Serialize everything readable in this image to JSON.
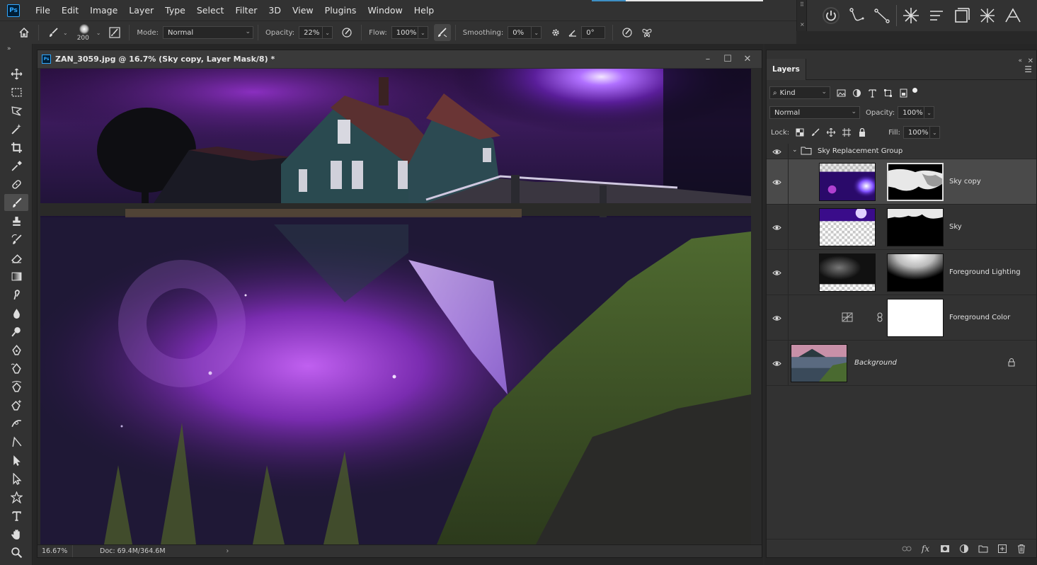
{
  "app": {
    "logo_text": "Ps",
    "menu": [
      "File",
      "Edit",
      "Image",
      "Layer",
      "Type",
      "Select",
      "Filter",
      "3D",
      "View",
      "Plugins",
      "Window",
      "Help"
    ]
  },
  "options_bar": {
    "brush_size": "200",
    "mode_label": "Mode:",
    "mode_value": "Normal",
    "opacity_label": "Opacity:",
    "opacity_value": "22%",
    "flow_label": "Flow:",
    "flow_value": "100%",
    "smoothing_label": "Smoothing:",
    "smoothing_value": "0%",
    "angle_value": "0°"
  },
  "document": {
    "title": "ZAN_3059.jpg @ 16.7% (Sky copy, Layer Mask/8) *",
    "zoom": "16.67%",
    "doc_size": "Doc: 69.4M/364.6M"
  },
  "layers_panel": {
    "tab_label": "Layers",
    "filter_kind": "Kind",
    "blend_mode": "Normal",
    "opacity_label": "Opacity:",
    "opacity_value": "100%",
    "lock_label": "Lock:",
    "fill_label": "Fill:",
    "fill_value": "100%",
    "layers": [
      {
        "name": "Sky Replacement Group",
        "type": "group"
      },
      {
        "name": "Sky copy",
        "type": "pixel_mask",
        "selected": true
      },
      {
        "name": "Sky",
        "type": "pixel_mask"
      },
      {
        "name": "Foreground Lighting",
        "type": "pixel_mask"
      },
      {
        "name": "Foreground Color",
        "type": "adjustment_mask"
      },
      {
        "name": "Background",
        "type": "background",
        "locked": true
      }
    ]
  },
  "colors": {
    "accent": "#31a8ff",
    "panel_bg": "#323232",
    "selected_row": "#4a4a4a"
  }
}
